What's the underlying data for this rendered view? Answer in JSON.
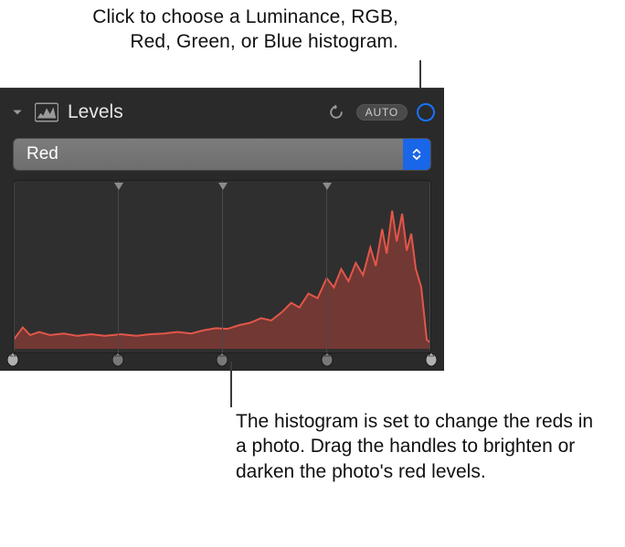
{
  "callouts": {
    "top": "Click to choose a Luminance, RGB, Red, Green, or Blue histogram.",
    "bottom": "The histogram is set to change the reds in a photo. Drag the handles to brighten or darken the photo's red levels."
  },
  "panel": {
    "title": "Levels",
    "auto_label": "AUTO"
  },
  "dropdown": {
    "selected": "Red"
  },
  "colors": {
    "histogram_stroke": "#e3564a",
    "histogram_fill": "rgba(170,63,55,0.55)",
    "accent": "#1873ff"
  },
  "histogram": {
    "slider_positions_pct": [
      0,
      25,
      50,
      75,
      100
    ],
    "gridlines_pct": [
      0,
      25,
      50,
      75,
      100
    ]
  }
}
